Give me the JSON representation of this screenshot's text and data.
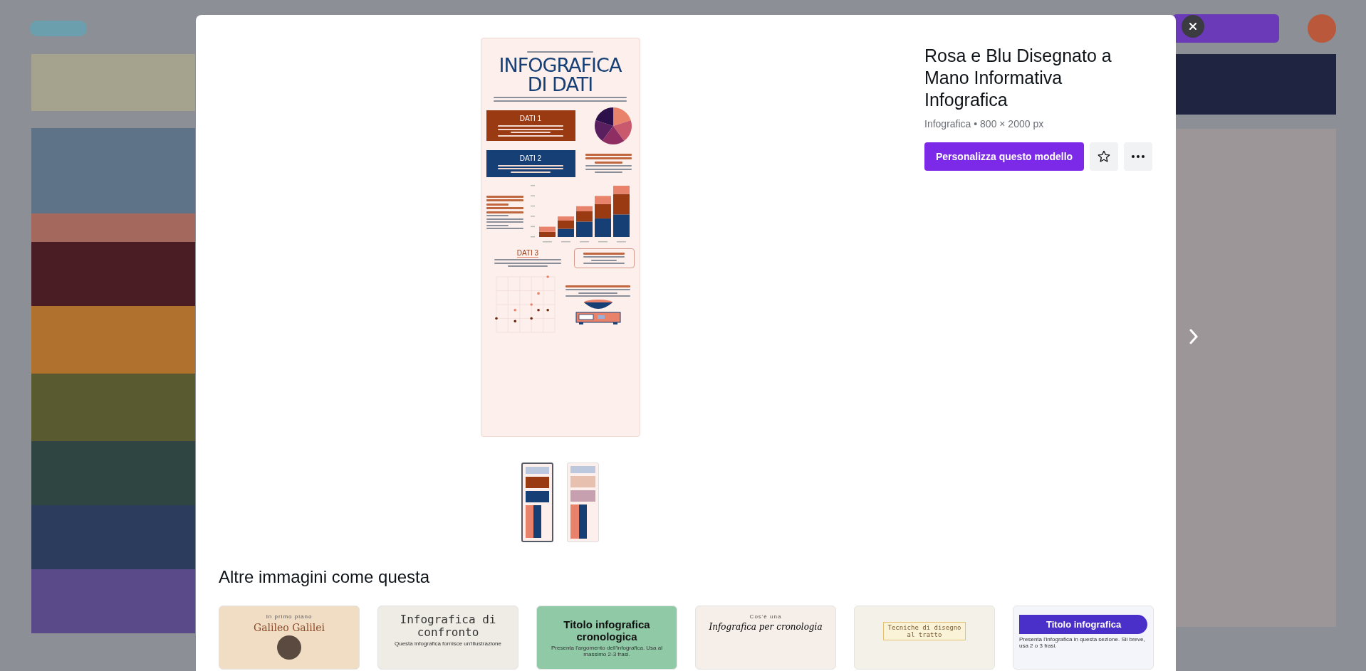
{
  "modal": {
    "preview": {
      "title": "INFOGRAFICA DI DATI",
      "headings": [
        "DATI 1",
        "DATI 2",
        "DATI 3"
      ]
    },
    "pages": [
      {
        "selected": true
      },
      {
        "selected": false
      }
    ],
    "title": "Rosa e Blu Disegnato a Mano Informativa Infografica",
    "meta": "Infografica • 800 × 2000 px",
    "customize_button": "Personalizza questo modello",
    "similar_heading": "Altre immagini come questa",
    "similar": [
      {
        "kicker": "In primo piano",
        "title": "Galileo Galilei"
      },
      {
        "title": "Infografica di confronto",
        "caption": "Questa infografica fornisce un'illustrazione"
      },
      {
        "title": "Titolo infografica cronologica",
        "caption": "Presenta l'argomento dell'infografica. Usa al massimo 2-3 frasi."
      },
      {
        "kicker": "Cos'è una",
        "title": "Infografica per cronologia"
      },
      {
        "title": "Tecniche di disegno al tratto"
      },
      {
        "title": "Titolo infografica",
        "caption": "Presenta l'infografica in questa sezione. Sii breve, usa 2 o 3 frasi."
      }
    ]
  }
}
